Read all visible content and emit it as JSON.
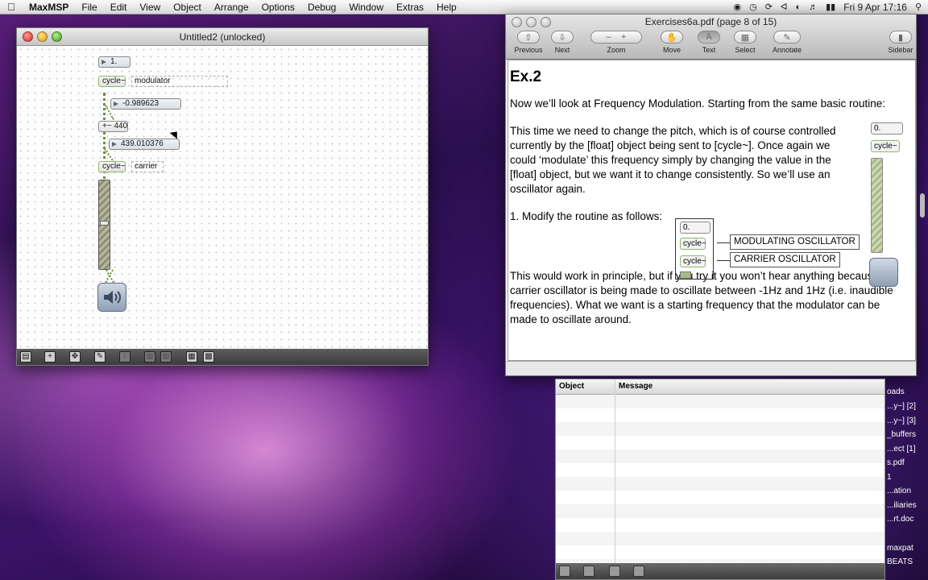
{
  "menubar": {
    "app": "MaxMSP",
    "items": [
      "File",
      "Edit",
      "View",
      "Object",
      "Arrange",
      "Options",
      "Debug",
      "Window",
      "Extras",
      "Help"
    ],
    "clock": "Fri 9 Apr  17:16"
  },
  "max_window": {
    "title": "Untitled2 (unlocked)",
    "objects": {
      "msg": "1.",
      "cycle1": "cycle~",
      "comment1": "modulator",
      "num1": "-0.989623",
      "plus": "+~ 440",
      "num2": "439.010376",
      "cycle2": "cycle~",
      "comment2": "carrier"
    }
  },
  "preview": {
    "title": "Exercises6a.pdf (page 8 of 15)",
    "toolbar": {
      "previous": "Previous",
      "next": "Next",
      "zoom": "Zoom",
      "move": "Move",
      "text": "Text",
      "select": "Select",
      "annotate": "Annotate",
      "sidebar": "Sidebar"
    },
    "content": {
      "heading": "Ex.2",
      "p1": "Now we’ll look at Frequency Modulation. Starting from the same basic routine:",
      "p2": "This time we need to change the pitch, which is of course controlled currently by the [float] object being sent to [cycle~]. Once again we could ‘modulate’ this frequency simply by changing the value in the [float] object, but we want it to change consistently. So we’ll use an oscillator again.",
      "p3": "1. Modify the routine as follows:",
      "p4": "This would work in principle, but if you try it you won’t hear anything because the carrier oscillator is being made to oscillate between -1Hz and 1Hz (i.e. inaudible frequencies). What we want is a starting frequency that the modulator can be made to oscillate around.",
      "fig1_num": "0.",
      "fig1_cycle": "cycle~",
      "fig2_num": "0.",
      "fig2_cycle1": "cycle~",
      "fig2_cycle2": "cycle~",
      "label_mod": "MODULATING OSCILLATOR",
      "label_car": "CARRIER OSCILLATOR"
    }
  },
  "max_console": {
    "col_object": "Object",
    "col_message": "Message"
  },
  "desktop_items": [
    "oads",
    "...y~] [2]",
    "...y~] [3]",
    "_buffers",
    "...ect [1]",
    "s.pdf",
    "1",
    "...ation",
    "...iliaries",
    "...rt.doc",
    "maxpat",
    "BEATS"
  ]
}
